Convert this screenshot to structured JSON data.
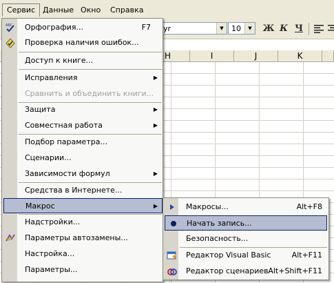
{
  "menubar": {
    "items": [
      "Сервис",
      "Данные",
      "Окно",
      "Справка"
    ]
  },
  "toolbar": {
    "font_name": "yr",
    "font_size": "10",
    "bold": "Ж",
    "italic": "К",
    "underline": "Ч"
  },
  "sheet": {
    "columns": [
      "H",
      "I",
      "J",
      "K"
    ]
  },
  "menu": {
    "items": [
      {
        "label": "Орфография...",
        "shortcut": "F7",
        "icon": "spellcheck-icon"
      },
      {
        "label": "Проверка наличия ошибок...",
        "icon": "error-check-icon"
      },
      {
        "label": "Доступ к книге..."
      },
      {
        "label": "Исправления",
        "submenu": true
      },
      {
        "label": "Сравнить и объединить книги...",
        "disabled": true
      },
      {
        "label": "Защита",
        "submenu": true
      },
      {
        "label": "Совместная работа",
        "submenu": true
      },
      {
        "label": "Подбор параметра..."
      },
      {
        "label": "Сценарии..."
      },
      {
        "label": "Зависимости формул",
        "submenu": true
      },
      {
        "label": "Средства в Интернете..."
      },
      {
        "label": "Макрос",
        "submenu": true,
        "highlighted": true
      },
      {
        "label": "Надстройки..."
      },
      {
        "label": "Параметры автозамены...",
        "icon": "autocorrect-icon"
      },
      {
        "label": "Настройка..."
      },
      {
        "label": "Параметры..."
      }
    ]
  },
  "submenu": {
    "items": [
      {
        "label": "Макросы...",
        "shortcut": "Alt+F8",
        "icon": "play-icon"
      },
      {
        "label": "Начать запись...",
        "icon": "record-icon",
        "highlighted": true
      },
      {
        "label": "Безопасность..."
      },
      {
        "label": "Редактор Visual Basic",
        "shortcut": "Alt+F11",
        "icon": "vb-editor-icon"
      },
      {
        "label": "Редактор сценариев",
        "shortcut": "Alt+Shift+F11",
        "icon": "script-editor-icon"
      }
    ]
  },
  "colors": {
    "highlight_bg": "#b6bdd2",
    "highlight_border": "#0a246a",
    "menubar_bg": "#ece9d8"
  }
}
